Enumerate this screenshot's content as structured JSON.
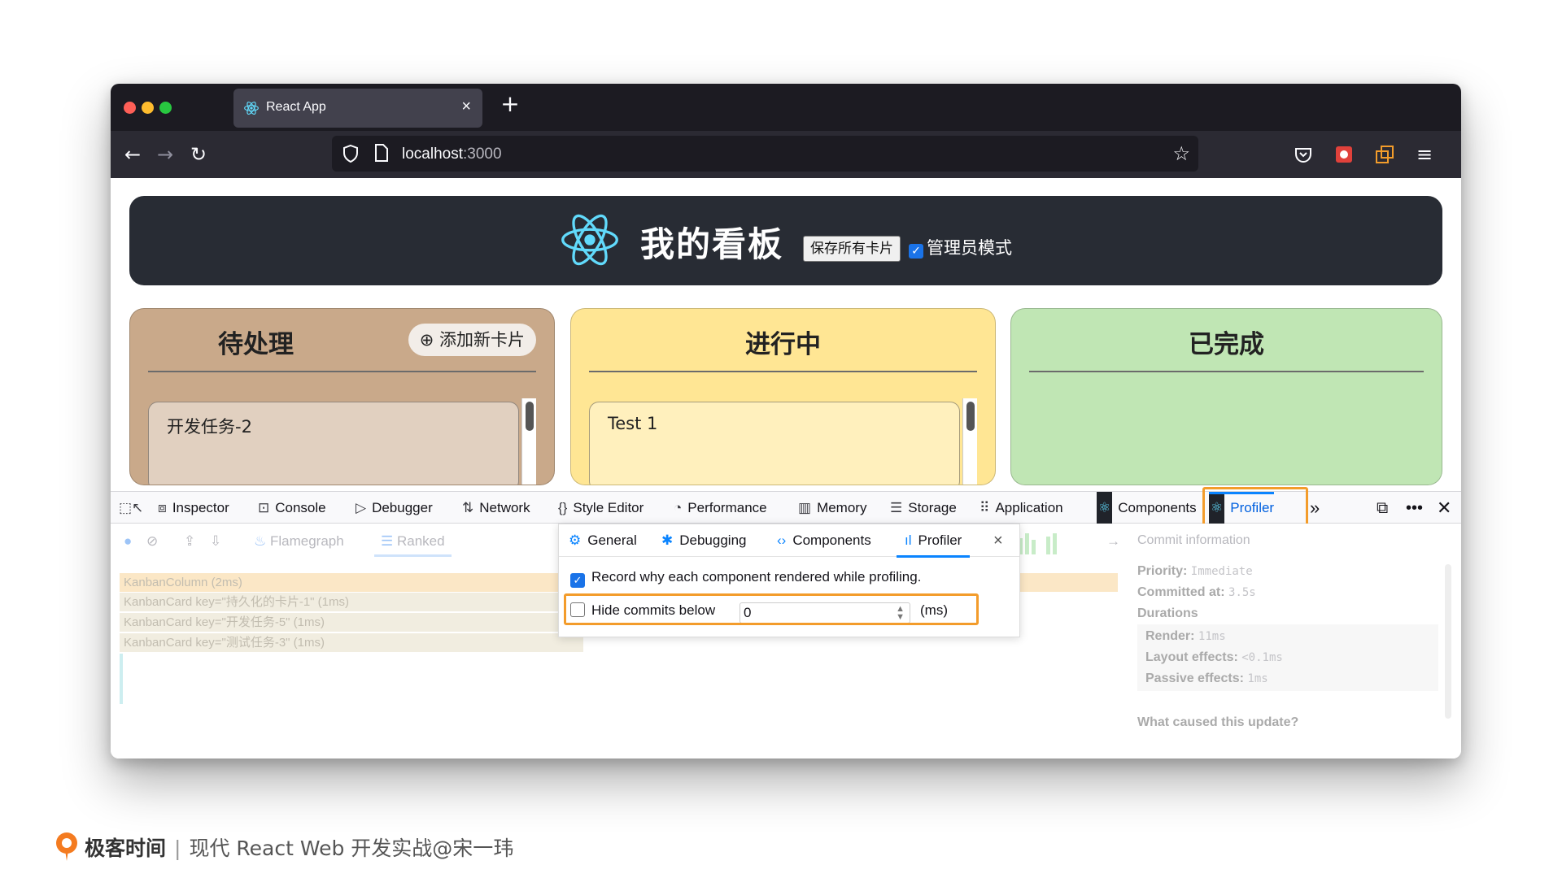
{
  "browser": {
    "tab_title": "React App",
    "tab_close": "×",
    "new_tab": "+",
    "url_host": "localhost",
    "url_port": ":3000"
  },
  "app": {
    "title": "我的看板",
    "save_all_label": "保存所有卡片",
    "admin_mode_label": "管理员模式",
    "admin_mode_checked": true,
    "columns": [
      {
        "title": "待处理",
        "bg": "#c9a98a",
        "card_bg": "#e1d0c0",
        "add_label": "⊕ 添加新卡片",
        "cards": [
          "开发任务-2"
        ]
      },
      {
        "title": "进行中",
        "bg": "#ffe694",
        "card_bg": "#fff0bd",
        "cards": [
          "Test 1"
        ]
      },
      {
        "title": "已完成",
        "bg": "#c0e6b4",
        "cards": []
      }
    ]
  },
  "devtools": {
    "tabs": [
      {
        "icon": "⧈",
        "label": "Inspector"
      },
      {
        "icon": "⊡",
        "label": "Console"
      },
      {
        "icon": "▷",
        "label": "Debugger"
      },
      {
        "icon": "⇅",
        "label": "Network"
      },
      {
        "icon": "{}",
        "label": "Style Editor"
      },
      {
        "icon": "◔",
        "label": "Performance"
      },
      {
        "icon": "▥",
        "label": "Memory"
      },
      {
        "icon": "☰",
        "label": "Storage"
      },
      {
        "icon": "⠿",
        "label": "Application"
      },
      {
        "icon": "⚛",
        "label": "Components"
      },
      {
        "icon": "⚛",
        "label": "Profiler"
      }
    ],
    "overflow": "»",
    "profiler_toolbar": {
      "flamegraph": "Flamegraph",
      "ranked": "Ranked"
    },
    "ranked_rows": [
      "KanbanColumn (2ms)",
      "KanbanCard key=\"持久化的卡片-1\" (1ms)",
      "KanbanCard key=\"开发任务-5\" (1ms)",
      "KanbanCard key=\"测试任务-3\" (1ms)"
    ],
    "commit_info": {
      "title": "Commit information",
      "priority_label": "Priority:",
      "priority_value": "Immediate",
      "committed_label": "Committed at:",
      "committed_value": "3.5s",
      "durations_label": "Durations",
      "render_label": "Render:",
      "render_value": "11ms",
      "layout_label": "Layout effects:",
      "layout_value": "<0.1ms",
      "passive_label": "Passive effects:",
      "passive_value": "1ms",
      "why_label": "What caused this update?"
    },
    "settings_popup": {
      "tabs": [
        {
          "icon": "⚙",
          "label": "General"
        },
        {
          "icon": "✱",
          "label": "Debugging"
        },
        {
          "icon": "‹›",
          "label": "Components"
        },
        {
          "icon": "ıl",
          "label": "Profiler"
        }
      ],
      "close": "×",
      "record_label": "Record why each component rendered while profiling.",
      "record_checked": true,
      "hide_label": "Hide commits below",
      "hide_value": "0",
      "hide_unit": "(ms)"
    }
  },
  "footer": {
    "brand": "极客时间",
    "separator": "|",
    "course": "现代 React Web 开发实战@宋一玮"
  }
}
